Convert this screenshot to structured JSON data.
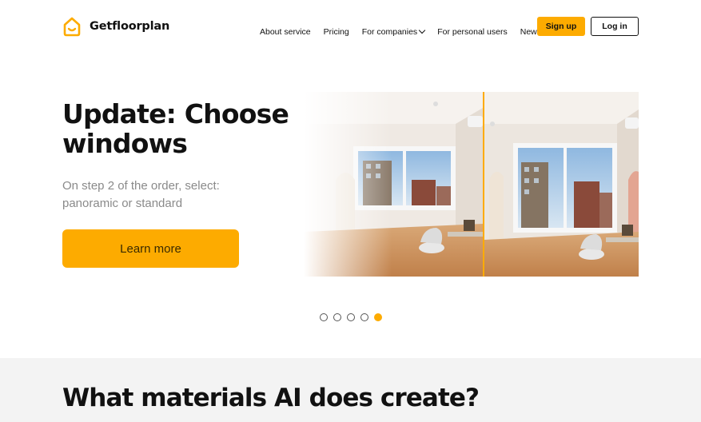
{
  "brand": {
    "name": "Getfloorplan",
    "accent_color": "#fdab00"
  },
  "nav": {
    "items": [
      {
        "label": "About service"
      },
      {
        "label": "Pricing"
      },
      {
        "label": "For companies",
        "has_dropdown": true
      },
      {
        "label": "For personal users"
      },
      {
        "label": "News"
      }
    ],
    "signup_label": "Sign up",
    "login_label": "Log in"
  },
  "hero": {
    "title": "Update: Choose windows",
    "subtitle": "On step 2 of the order, select: panoramic or standard",
    "cta_label": "Learn more",
    "image_icon": "room-comparison-image"
  },
  "carousel": {
    "slide_count": 5,
    "active_index": 4
  },
  "materials": {
    "title": "What materials AI does create?"
  }
}
